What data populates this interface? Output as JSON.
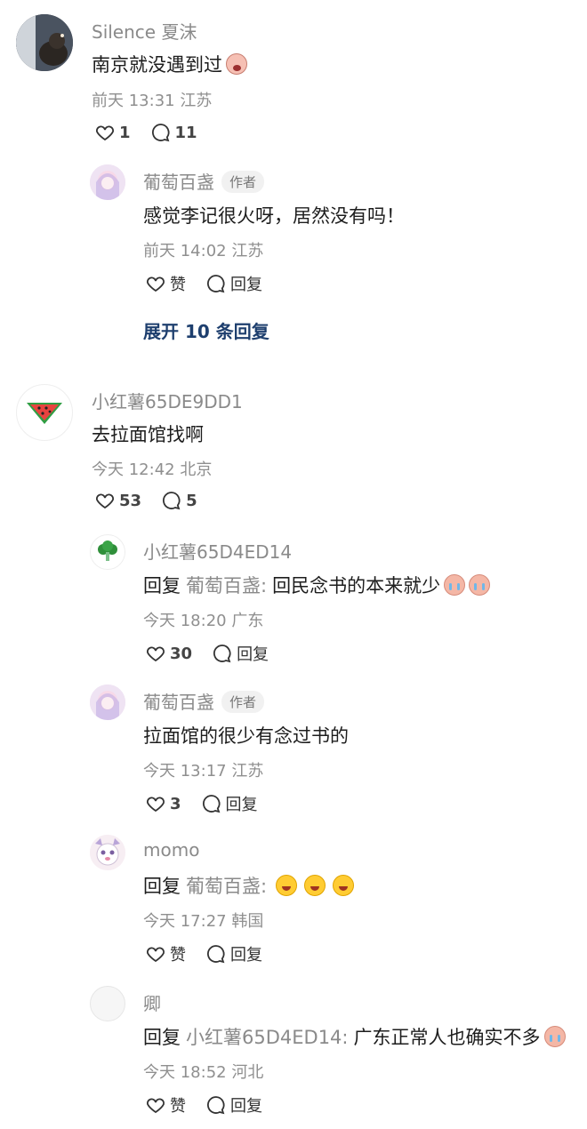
{
  "comments": [
    {
      "name": "Silence 夏沫",
      "text": "南京就没遇到过",
      "meta": "前天 13:31 江苏",
      "likes": "1",
      "replies": "11",
      "avatar": "cat-photo-avatar"
    },
    {
      "name": "葡萄百盏",
      "badge": "作者",
      "text": "感觉李记很火呀，居然没有吗！",
      "meta": "前天 14:02 江苏",
      "like_label": "赞",
      "reply_label": "回复",
      "avatar": "anime-girl-avatar"
    },
    {
      "expand_label": "展开 10 条回复"
    },
    {
      "name": "小红薯65DE9DD1",
      "text": "去拉面馆找啊",
      "meta": "今天 12:42 北京",
      "likes": "53",
      "replies": "5",
      "avatar": "watermelon-avatar"
    },
    {
      "name": "小红薯65D4ED14",
      "reply_prefix": "回复",
      "reply_target": "葡萄百盏:",
      "text": "回民念书的本来就少",
      "meta": "今天 18:20 广东",
      "likes": "30",
      "reply_label": "回复",
      "avatar": "broccoli-avatar"
    },
    {
      "name": "葡萄百盏",
      "badge": "作者",
      "text": "拉面馆的很少有念过书的",
      "meta": "今天 13:17 江苏",
      "likes": "3",
      "reply_label": "回复",
      "avatar": "anime-girl-avatar"
    },
    {
      "name": "momo",
      "reply_prefix": "回复",
      "reply_target": "葡萄百盏:",
      "text": "",
      "meta": "今天 17:27 韩国",
      "like_label": "赞",
      "reply_label": "回复",
      "avatar": "cartoon-avatar"
    },
    {
      "name": "卿",
      "reply_prefix": "回复",
      "reply_target": "小红薯65D4ED14:",
      "text": "广东正常人也确实不多",
      "meta": "今天 18:52 河北",
      "like_label": "赞",
      "reply_label": "回复",
      "avatar": "blank-avatar"
    }
  ],
  "colors": {
    "name": "#8a8a8a",
    "meta": "#8f8f8f",
    "expand": "#1e3f6e",
    "badge_bg": "#f1f1f1"
  }
}
